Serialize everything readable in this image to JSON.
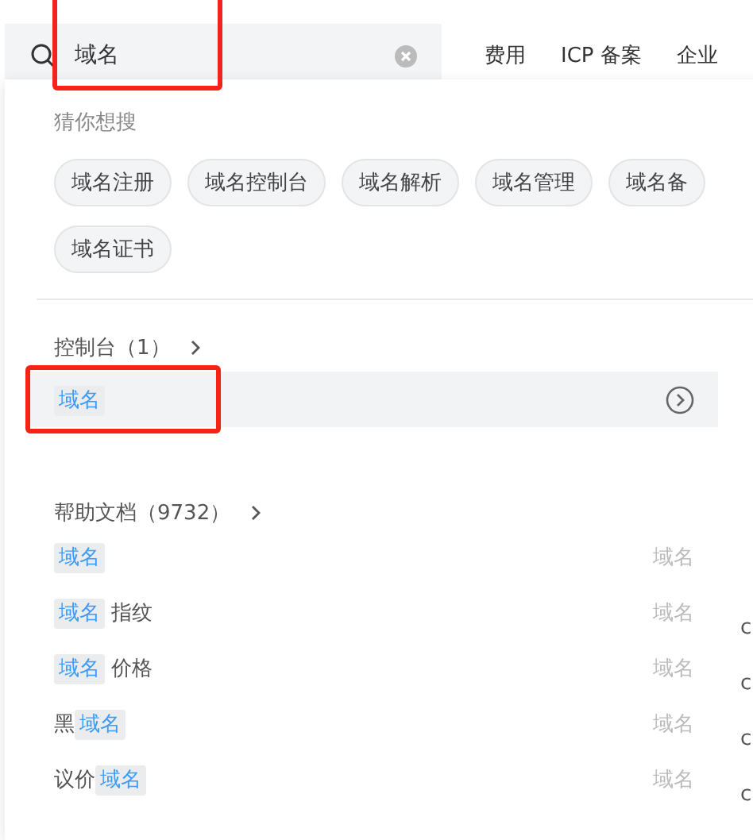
{
  "search": {
    "value": "域名"
  },
  "nav": [
    "费用",
    "ICP 备案",
    "企业"
  ],
  "suggest": {
    "title": "猜你想搜",
    "tags": [
      "域名注册",
      "域名控制台",
      "域名解析",
      "域名管理",
      "域名备",
      "域名证书"
    ]
  },
  "console": {
    "title": "控制台（1）",
    "items": [
      {
        "parts": [
          {
            "text": "域名",
            "highlight": true
          }
        ],
        "selected": true
      }
    ]
  },
  "help": {
    "title": "帮助文档（9732）",
    "items": [
      {
        "parts": [
          {
            "text": "域名",
            "highlight": true
          }
        ],
        "category": "域名"
      },
      {
        "parts": [
          {
            "text": "域名",
            "highlight": true
          },
          {
            "text": " 指纹",
            "highlight": false
          }
        ],
        "category": "域名"
      },
      {
        "parts": [
          {
            "text": "域名",
            "highlight": true
          },
          {
            "text": " 价格",
            "highlight": false
          }
        ],
        "category": "域名"
      },
      {
        "parts": [
          {
            "text": "黑",
            "highlight": false
          },
          {
            "text": "域名",
            "highlight": true
          }
        ],
        "category": "域名"
      },
      {
        "parts": [
          {
            "text": "议价",
            "highlight": false
          },
          {
            "text": "域名",
            "highlight": true
          }
        ],
        "category": "域名"
      }
    ]
  },
  "side": [
    "c",
    "c",
    "c",
    "c"
  ]
}
